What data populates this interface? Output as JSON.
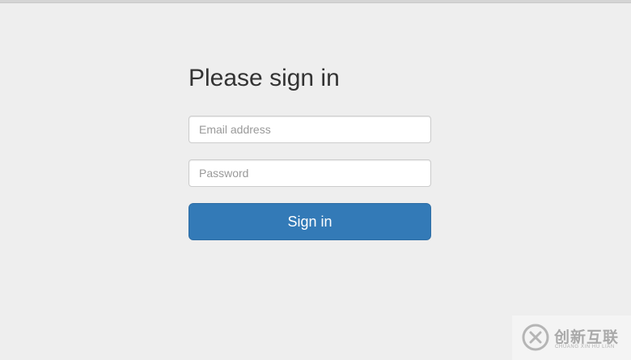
{
  "form": {
    "heading": "Please sign in",
    "email_placeholder": "Email address",
    "password_placeholder": "Password",
    "submit_label": "Sign in"
  },
  "watermark": {
    "title": "创新互联",
    "subtitle": "CHUANG XIN HU LIAN",
    "icon": "logo-icon"
  },
  "colors": {
    "background": "#eeeeee",
    "primary_button": "#337ab7",
    "heading_text": "#333333"
  }
}
